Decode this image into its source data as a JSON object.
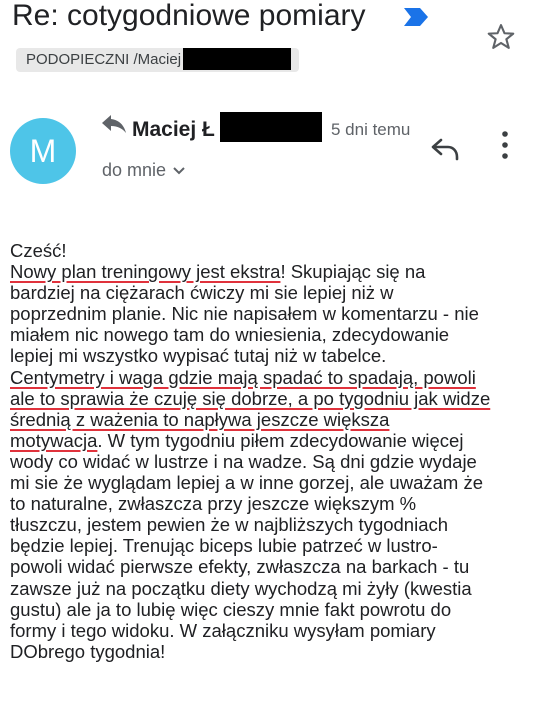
{
  "subject": "Re: cotygodniowe pomiary",
  "label": "PODOPIECZNI /Maciej",
  "avatar_letter": "M",
  "sender": "Maciej Ł",
  "time": "5 dni temu",
  "recipient": "do mnie",
  "colors": {
    "avatar": "#4ec5e8",
    "important": "#1a73e8",
    "underline": "#e0323c"
  },
  "icons": [
    "important-marker-icon",
    "star-icon",
    "reply-icon",
    "more-vert-icon",
    "chevron-down-icon"
  ],
  "body": {
    "l1": "Cześć!",
    "l2a": "Nowy plan treningowy jest ekstra",
    "l2b": "! Skupiając się na",
    "l3": "bardziej na ciężarach ćwiczy mi sie lepiej niż w",
    "l4": "poprzednim planie. Nic nie napisałem w komentarzu - nie",
    "l5": "miałem nic nowego tam do wniesienia, zdecydowanie",
    "l6": "lepiej mi wszystko wypisać tutaj niż w tabelce.",
    "l7": "Centymetry i waga gdzie mają spadać to spadają, powoli",
    "l8": "ale to sprawia że czuję się dobrze, a po tygodniu jak widze",
    "l9": "średnią z ważenia to napływa jeszcze większa",
    "l10a": "motywacja",
    "l10b": ". W tym tygodniu piłem zdecydowanie więcej",
    "l11": "wody co widać w lustrze i na wadze. Są dni gdzie wydaje",
    "l12": "mi sie że wyglądam lepiej a w inne gorzej, ale uważam że",
    "l13": "to naturalne, zwłaszcza przy jeszcze większym %",
    "l14": "tłuszczu, jestem pewien że w najbliższych tygodniach",
    "l15": "będzie lepiej. Trenując biceps lubie patrzeć w lustro-",
    "l16": "powoli widać pierwsze efekty, zwłaszcza na barkach - tu",
    "l17": "zawsze już na początku diety wychodzą mi żyły (kwestia",
    "l18": "gustu) ale ja to lubię więc cieszy mnie fakt powrotu do",
    "l19": "formy i tego widoku. W załączniku wysyłam pomiary",
    "l20": "DObrego tygodnia!"
  }
}
